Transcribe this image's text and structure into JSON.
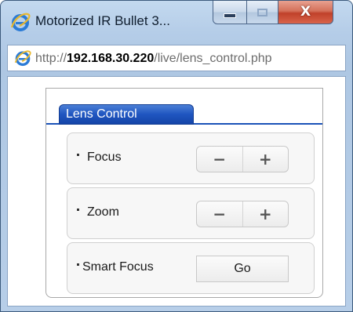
{
  "window": {
    "title": "Motorized IR Bullet 3...",
    "minimize_icon": "minimize-icon",
    "maximize_icon": "maximize-icon",
    "close_icon": "close-icon",
    "close_glyph": "X"
  },
  "address": {
    "prefix": "http://",
    "host": "192.168.30.220",
    "path": "/live/lens_control.php",
    "browser_icon": "internet-explorer-icon"
  },
  "lens_control": {
    "tab_label": "Lens Control",
    "rows": [
      {
        "label": "Focus",
        "minus": "−",
        "plus": "+"
      },
      {
        "label": "Zoom",
        "minus": "−",
        "plus": "+"
      },
      {
        "label": "Smart Focus",
        "action": "Go"
      }
    ]
  },
  "colors": {
    "tab_blue": "#1f55c0",
    "close_red": "#c0412a",
    "frame_blue": "#b5cde8"
  }
}
